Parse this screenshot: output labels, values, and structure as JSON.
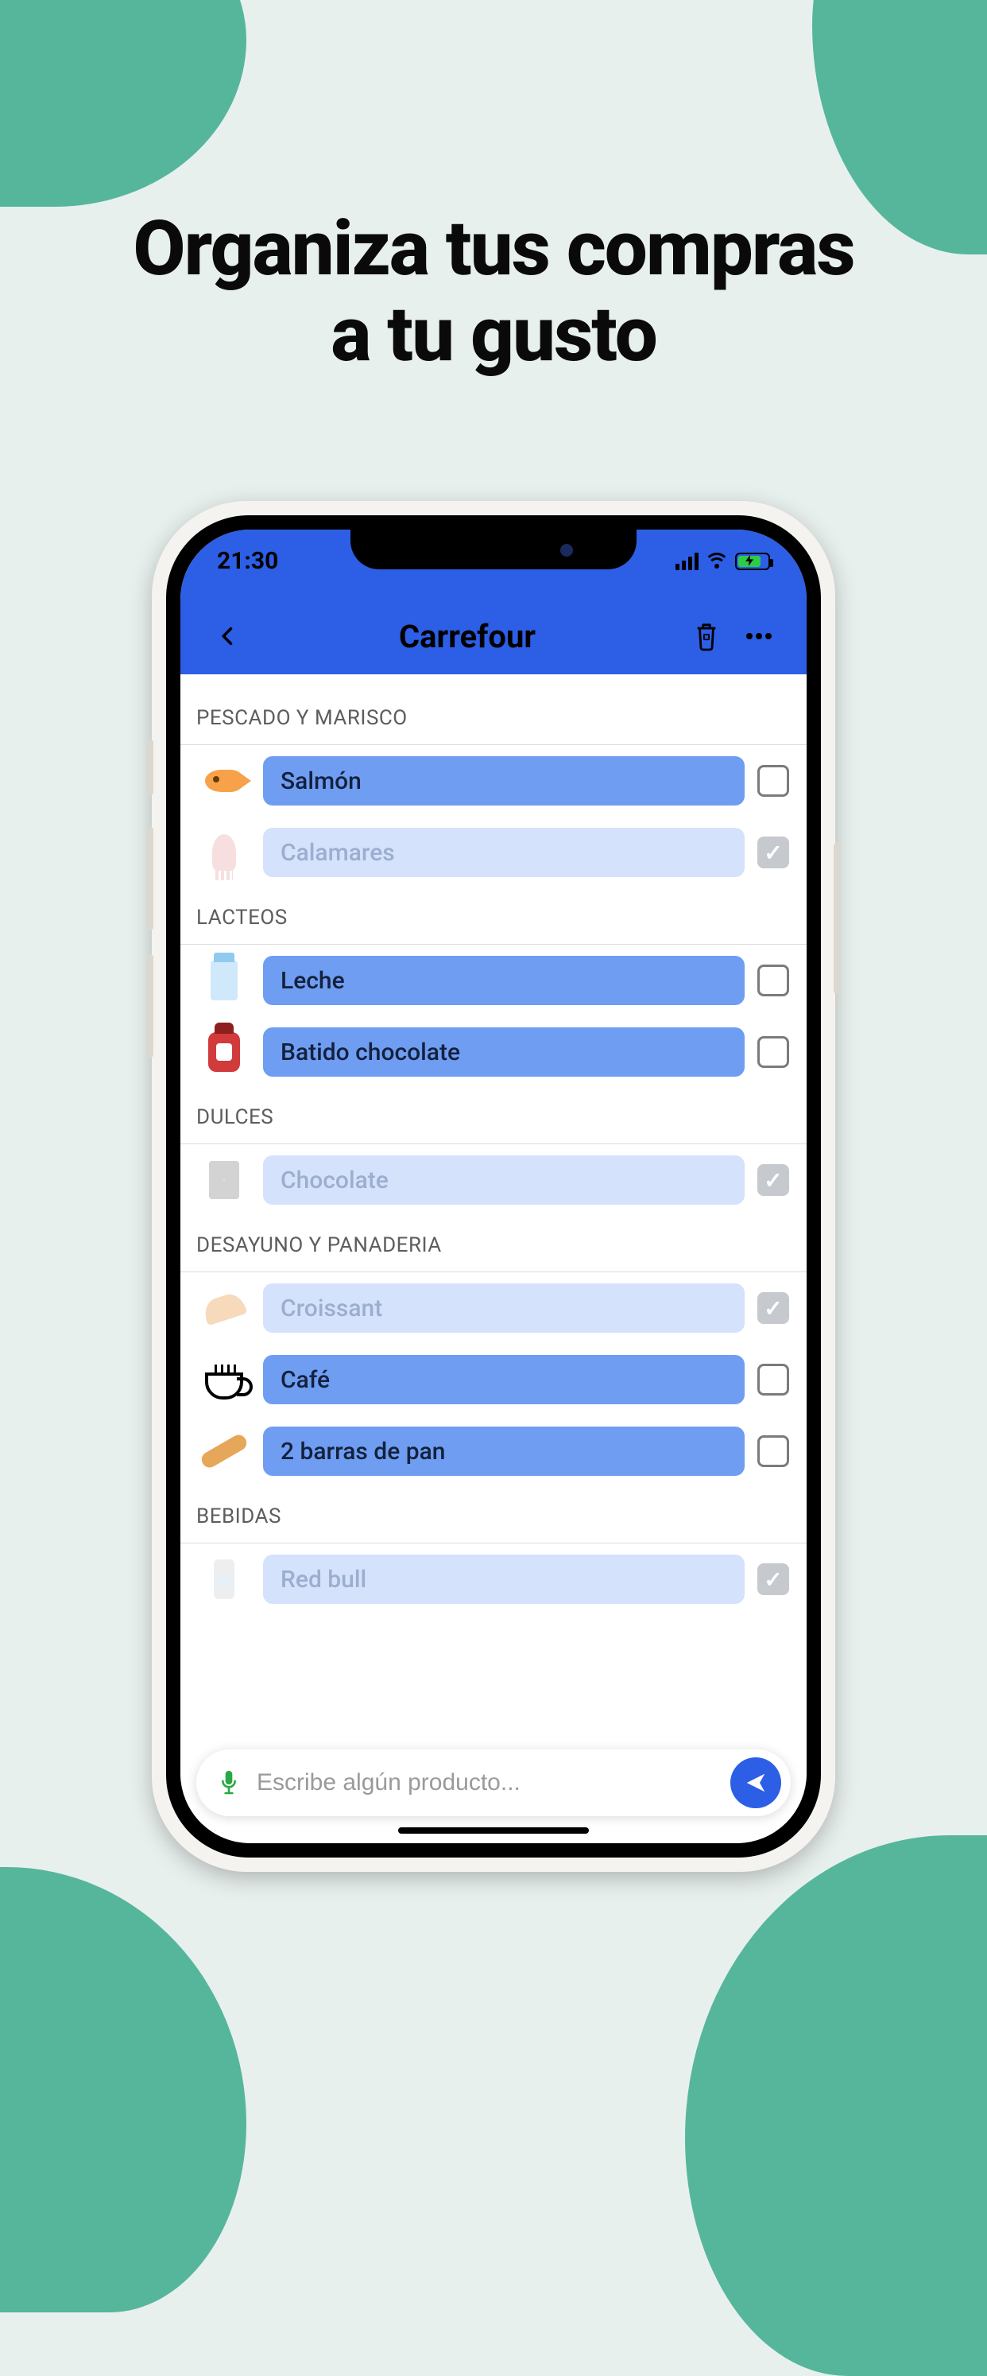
{
  "hero": {
    "line1": "Organiza tus compras",
    "line2": "a tu gusto"
  },
  "status": {
    "time": "21:30"
  },
  "header": {
    "title": "Carrefour"
  },
  "sections": [
    {
      "name": "PESCADO Y MARISCO",
      "items": [
        {
          "label": "Salmón",
          "checked": false,
          "icon": "fish-icon"
        },
        {
          "label": "Calamares",
          "checked": true,
          "icon": "squid-icon"
        }
      ]
    },
    {
      "name": "LACTEOS",
      "items": [
        {
          "label": "Leche",
          "checked": false,
          "icon": "milk-icon"
        },
        {
          "label": "Batido chocolate",
          "checked": false,
          "icon": "shake-icon"
        }
      ]
    },
    {
      "name": "DULCES",
      "items": [
        {
          "label": "Chocolate",
          "checked": true,
          "icon": "chocolate-icon"
        }
      ]
    },
    {
      "name": "DESAYUNO Y PANADERIA",
      "items": [
        {
          "label": "Croissant",
          "checked": true,
          "icon": "croissant-icon"
        },
        {
          "label": "Café",
          "checked": false,
          "icon": "coffee-icon"
        },
        {
          "label": "2 barras de pan",
          "checked": false,
          "icon": "bread-icon"
        }
      ]
    },
    {
      "name": "BEBIDAS",
      "items": [
        {
          "label": "Red bull",
          "checked": true,
          "icon": "energy-can-icon"
        }
      ]
    }
  ],
  "composer": {
    "placeholder": "Escribe algún producto..."
  },
  "iconClass": {
    "fish-icon": "ic-fish",
    "squid-icon": "ic-squid",
    "milk-icon": "ic-milk",
    "shake-icon": "ic-shake",
    "chocolate-icon": "ic-choc",
    "croissant-icon": "ic-crois",
    "coffee-icon": "ic-coffee",
    "bread-icon": "ic-bread",
    "energy-can-icon": "ic-can"
  }
}
